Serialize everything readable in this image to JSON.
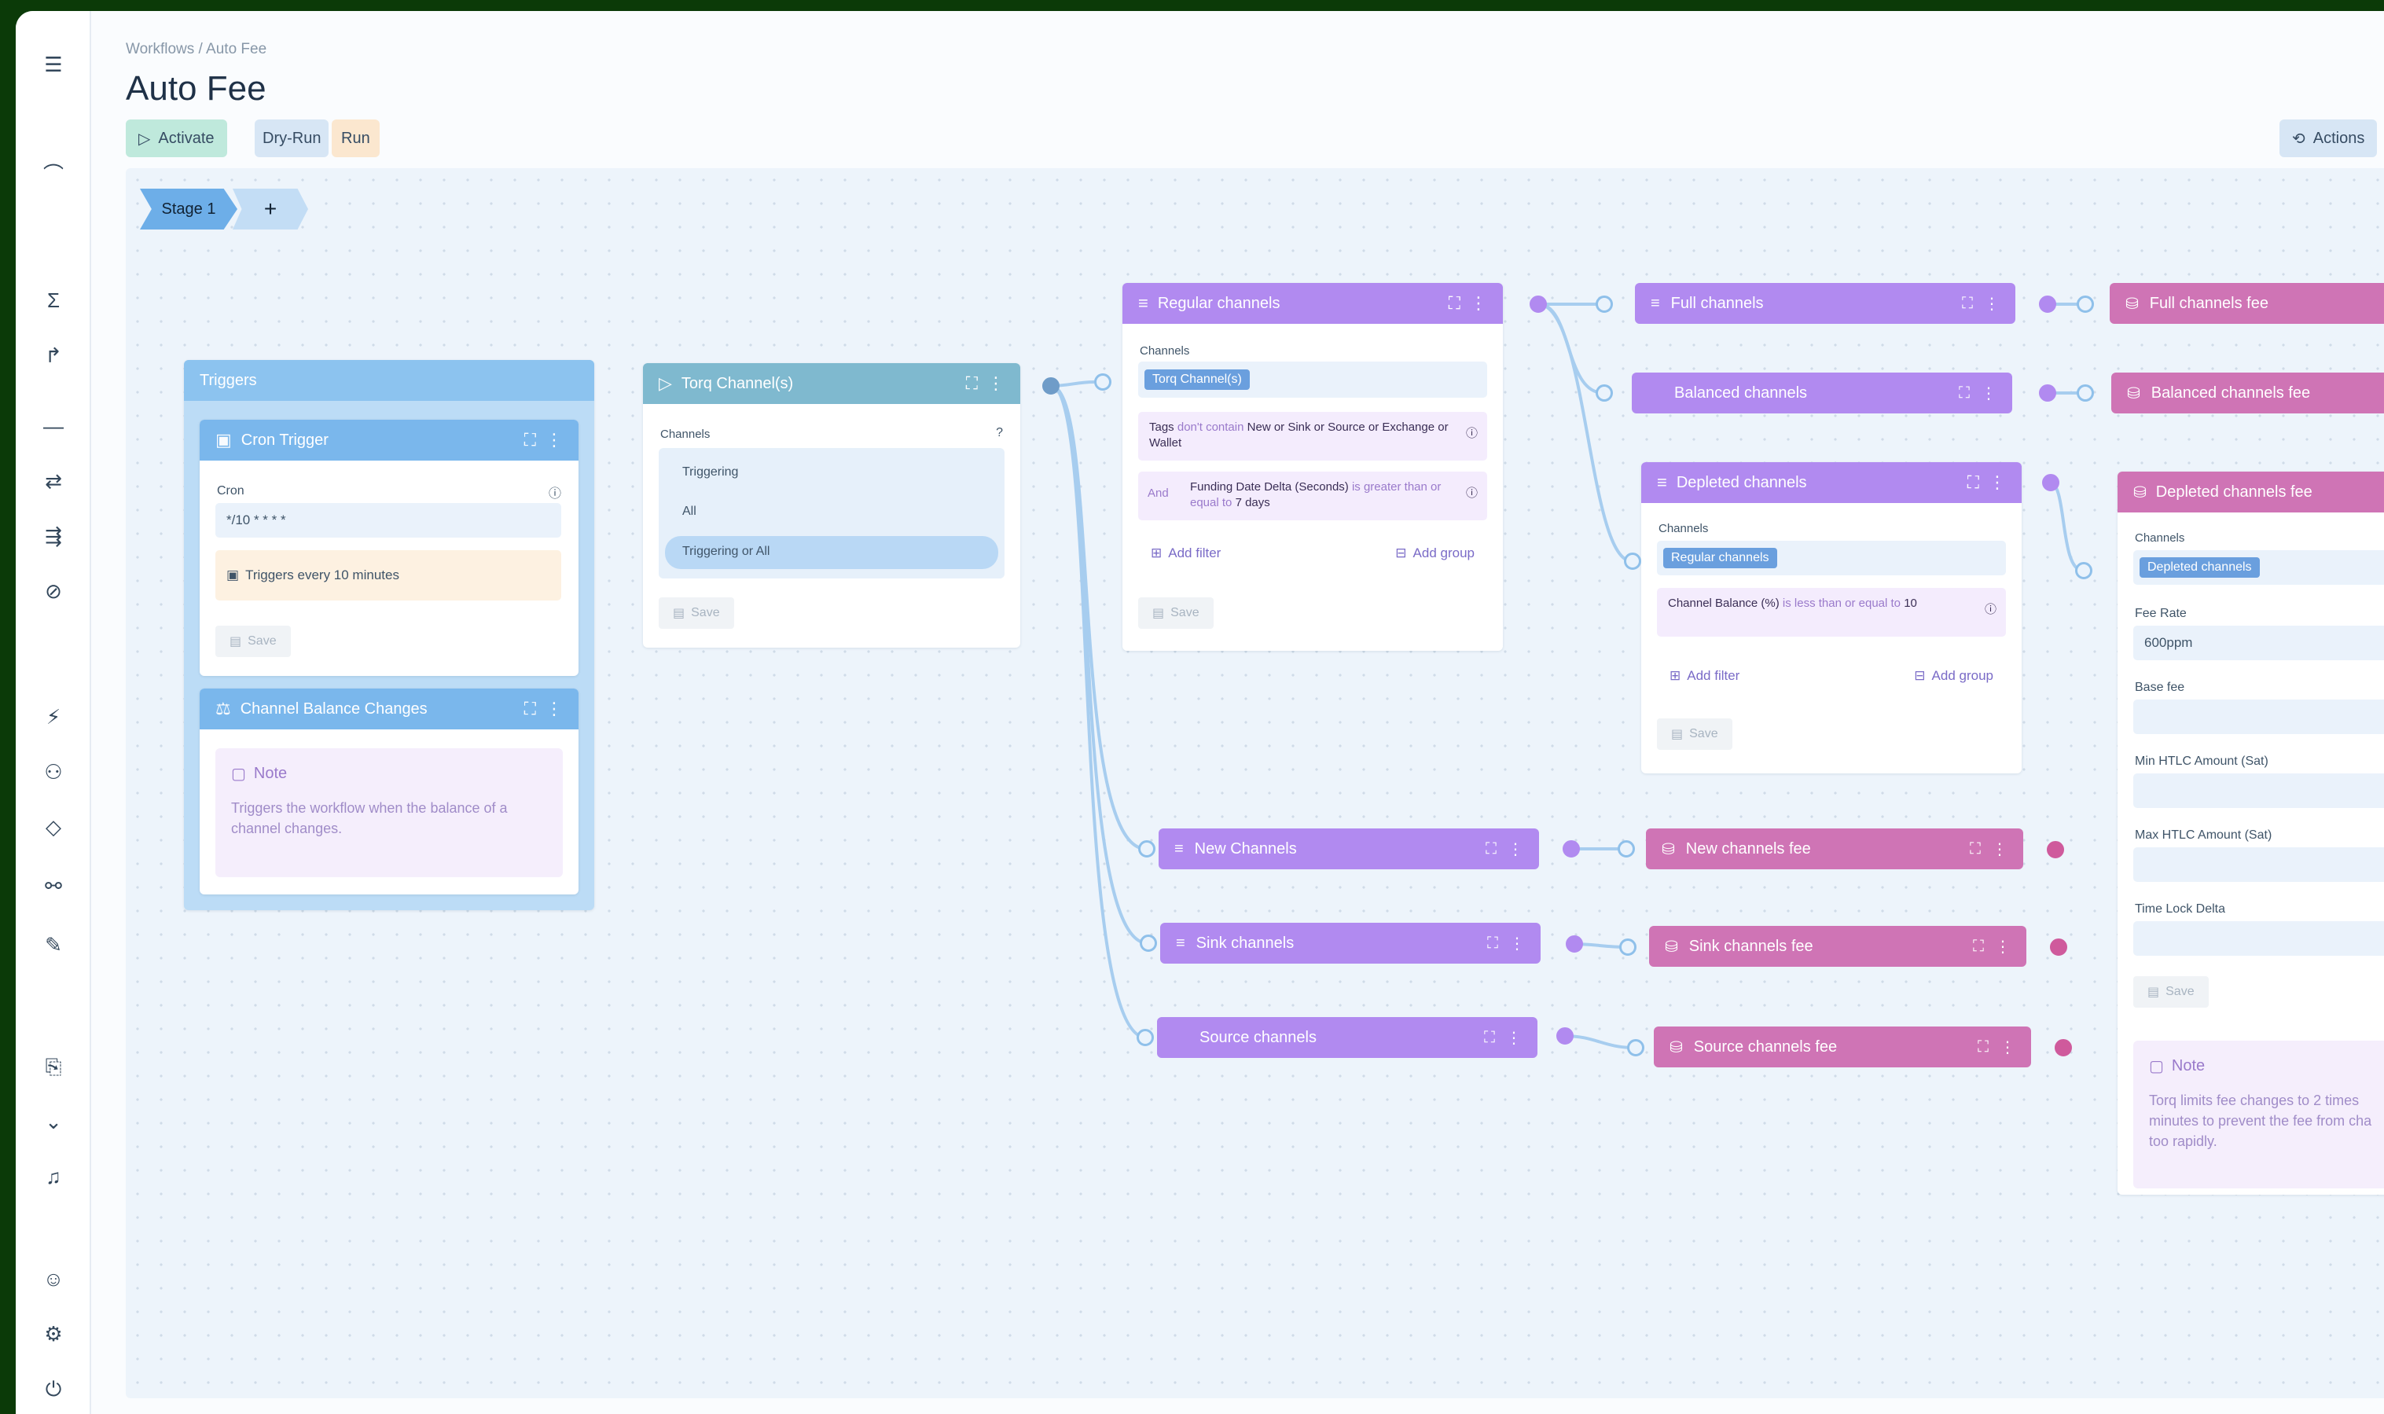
{
  "breadcrumb": "Workflows / Auto Fee",
  "title": "Auto Fee",
  "toolbar": {
    "activate": "Activate",
    "dry_run": "Dry-Run",
    "run": "Run",
    "actions": "Actions"
  },
  "stages": {
    "stage1": "Stage 1",
    "add": "+"
  },
  "triggers": {
    "header": "Triggers",
    "cron": {
      "title": "Cron Trigger",
      "field_label": "Cron",
      "value": "*/10 * * * *",
      "info": "Triggers every 10 minutes",
      "save": "Save"
    },
    "balance": {
      "title": "Channel Balance Changes",
      "note_title": "Note",
      "note_text": "Triggers the workflow when the balance of a channel changes."
    }
  },
  "torq_channels": {
    "title": "Torq Channel(s)",
    "label": "Channels",
    "options": [
      "Triggering",
      "All",
      "Triggering or All"
    ],
    "selected": "Triggering or All",
    "save": "Save"
  },
  "regular_channels": {
    "title": "Regular channels",
    "label": "Channels",
    "chip": "Torq Channel(s)",
    "filter1": {
      "a": "Tags",
      "b": "don't contain",
      "c": "New or Sink or Source or Exchange or Wallet"
    },
    "filter2": {
      "and": "And",
      "a": "Funding Date Delta (Seconds)",
      "b": "is greater than or equal to",
      "c": "7 days"
    },
    "add_filter": "Add filter",
    "add_group": "Add group",
    "save": "Save"
  },
  "full_channels": {
    "title": "Full channels"
  },
  "balanced_channels": {
    "title": "Balanced channels"
  },
  "depleted_channels": {
    "title": "Depleted channels",
    "label": "Channels",
    "chip": "Regular channels",
    "filter": {
      "a": "Channel Balance (%)",
      "b": "is less than or equal to",
      "c": "10"
    },
    "add_filter": "Add filter",
    "add_group": "Add group",
    "save": "Save"
  },
  "new_channels": {
    "title": "New Channels"
  },
  "sink_channels": {
    "title": "Sink channels"
  },
  "source_channels": {
    "title": "Source channels"
  },
  "fees": {
    "full": "Full channels fee",
    "balanced": "Balanced channels fee",
    "new": "New channels fee",
    "sink": "Sink channels fee",
    "source": "Source channels fee"
  },
  "depleted_fee": {
    "title": "Depleted channels fee",
    "channels_label": "Channels",
    "chip": "Depleted channels",
    "fee_rate_label": "Fee Rate",
    "fee_rate_value": "600ppm",
    "base_fee_label": "Base fee",
    "min_htlc_label": "Min HTLC Amount (Sat)",
    "max_htlc_label": "Max HTLC Amount (Sat)",
    "time_lock_label": "Time Lock Delta",
    "save": "Save",
    "note_title": "Note",
    "note_text": "Torq limits fee changes to 2 times minutes to prevent the fee from cha too rapidly."
  },
  "colors": {
    "purple": "#b18af0",
    "pink": "#cf74b5",
    "blue": "#7ab7ec",
    "teal": "#7fb9cf"
  }
}
